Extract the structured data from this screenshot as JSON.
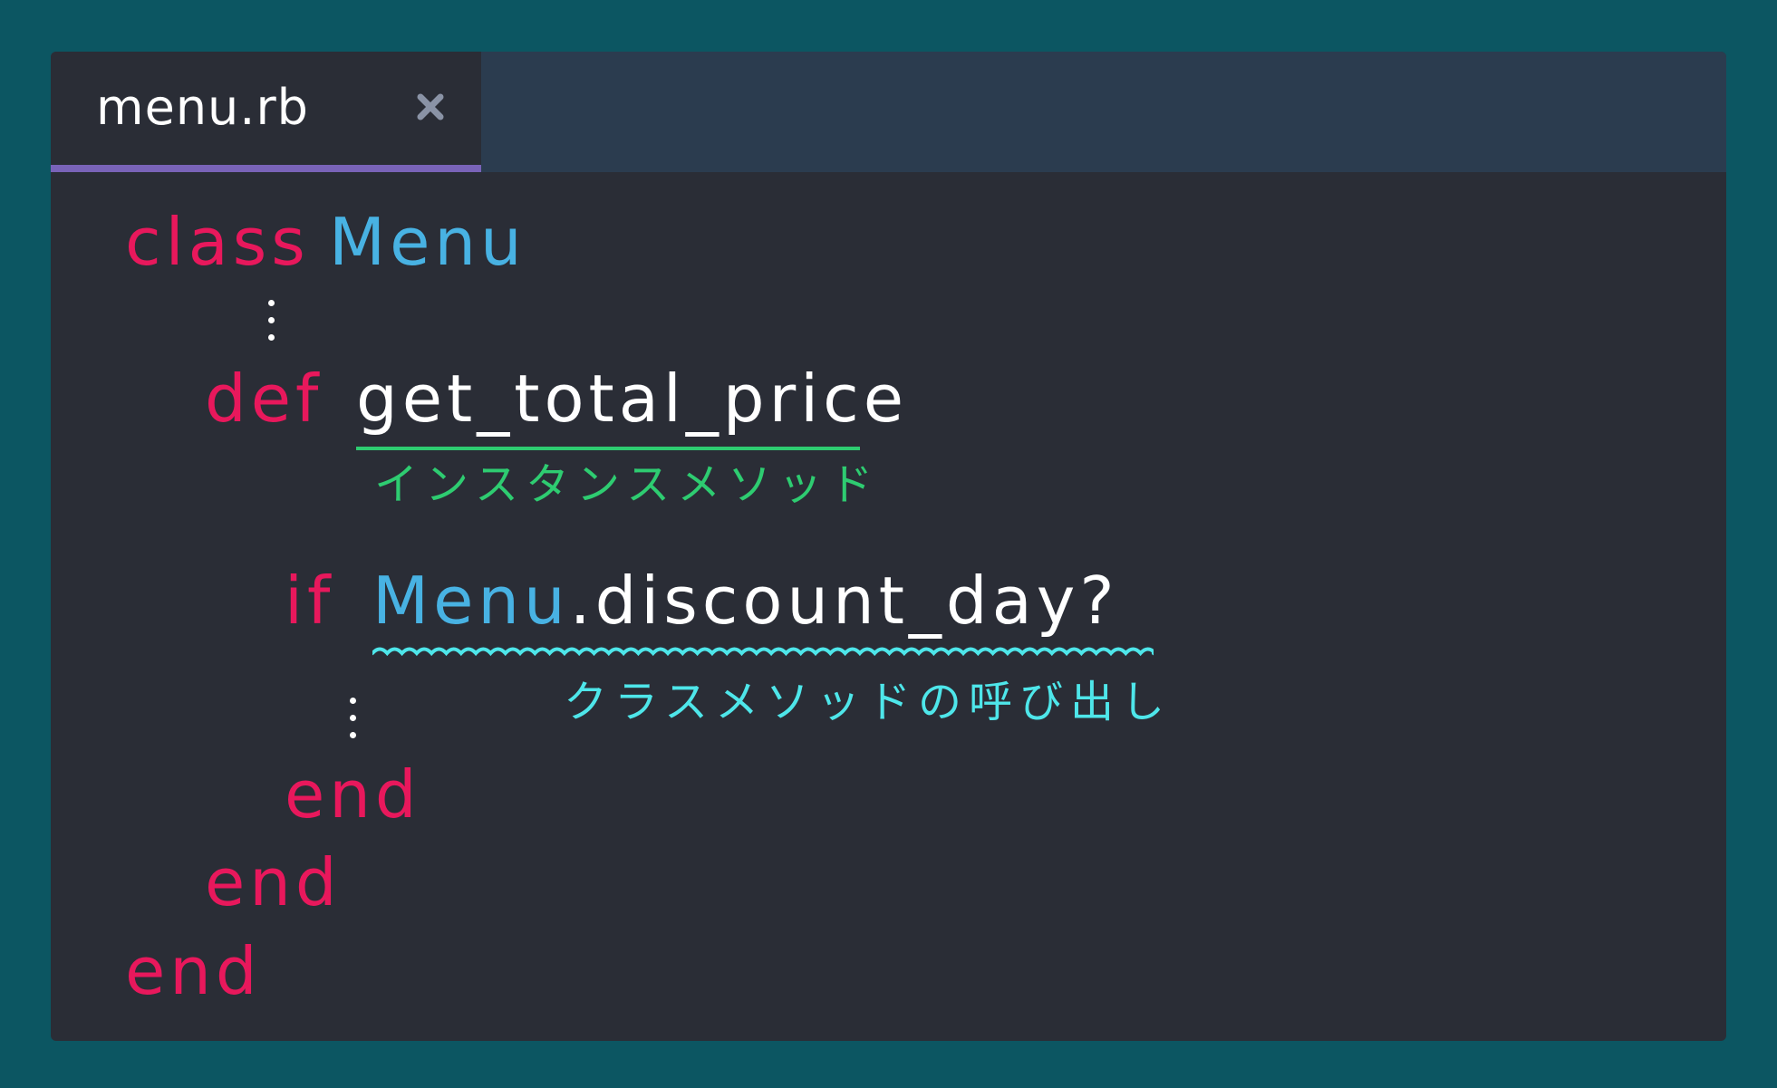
{
  "tab": {
    "filename": "menu.rb",
    "close_icon": "close-icon"
  },
  "code": {
    "line1_keyword": "class",
    "line1_const": "Menu",
    "line3_keyword": "def",
    "line3_method": "get_total_price",
    "line5_keyword": "if",
    "line5_const": "Menu",
    "line5_call": ".discount_day?",
    "line7_end": "end",
    "line8_end": "end",
    "line9_end": "end"
  },
  "annotations": {
    "instance_method": "インスタンスメソッド",
    "class_method_call": "クラスメソッドの呼び出し"
  },
  "colors": {
    "background": "#0c5662",
    "editor": "#2a2d36",
    "tabbar": "#2b3c4f",
    "tab_accent": "#7963b8",
    "keyword": "#e8185c",
    "constant": "#48b2e3",
    "identifier": "#ffffff",
    "annotation_green": "#2ecc71",
    "annotation_cyan": "#4ee6ea"
  }
}
